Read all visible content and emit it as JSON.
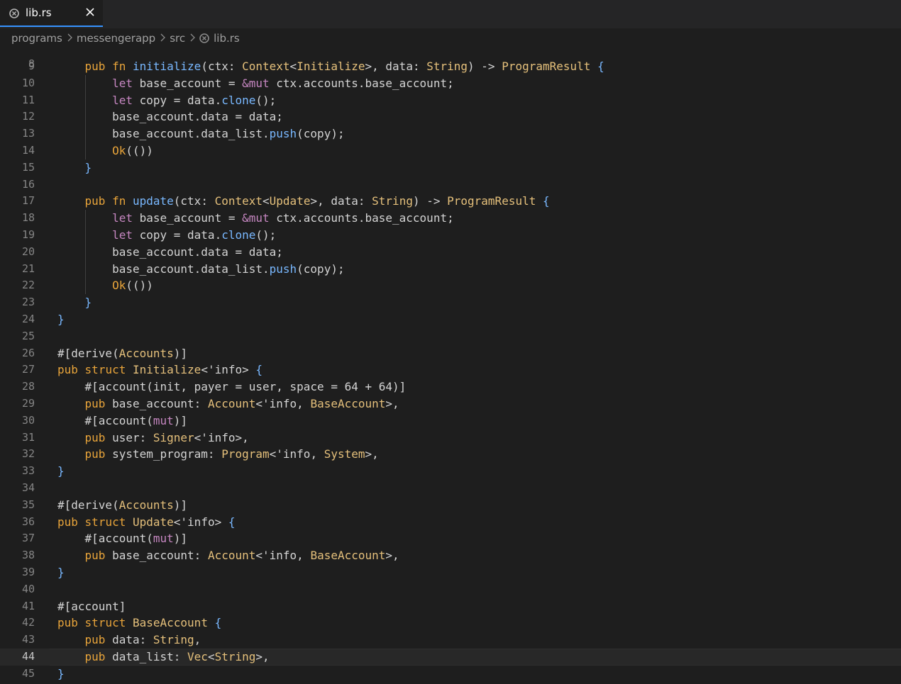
{
  "tab": {
    "label": "lib.rs",
    "icon": "rust-file-icon",
    "close_icon": "close-icon"
  },
  "breadcrumb": [
    "programs",
    "messengerapp",
    "src",
    "lib.rs"
  ],
  "editor": {
    "first_partial_line": "8",
    "current_line": 44,
    "lines": [
      {
        "n": 9,
        "segs": [
          [
            "    ",
            ""
          ],
          [
            "pub",
            "kw"
          ],
          [
            " ",
            ""
          ],
          [
            "fn",
            "kw"
          ],
          [
            " ",
            ""
          ],
          [
            "initialize",
            "fn"
          ],
          [
            "(ctx: ",
            ""
          ],
          [
            "Context",
            "ty"
          ],
          [
            "<",
            ""
          ],
          [
            "Initialize",
            "ty"
          ],
          [
            ">, data: ",
            ""
          ],
          [
            "String",
            "ty"
          ],
          [
            ") -> ",
            ""
          ],
          [
            "ProgramResult",
            "ty"
          ],
          [
            " ",
            ""
          ],
          [
            "{",
            "brace"
          ]
        ]
      },
      {
        "n": 10,
        "segs": [
          [
            "        ",
            ""
          ],
          [
            "let",
            "kw2"
          ],
          [
            " base_account = ",
            ""
          ],
          [
            "&mut",
            "mut"
          ],
          [
            " ctx.accounts.base_account;",
            ""
          ]
        ]
      },
      {
        "n": 11,
        "segs": [
          [
            "        ",
            ""
          ],
          [
            "let",
            "kw2"
          ],
          [
            " copy = data.",
            ""
          ],
          [
            "clone",
            "fn"
          ],
          [
            "();",
            ""
          ]
        ]
      },
      {
        "n": 12,
        "segs": [
          [
            "        base_account.data = data;",
            ""
          ]
        ]
      },
      {
        "n": 13,
        "segs": [
          [
            "        base_account.data_list.",
            ""
          ],
          [
            "push",
            "fn"
          ],
          [
            "(copy);",
            ""
          ]
        ]
      },
      {
        "n": 14,
        "segs": [
          [
            "        ",
            ""
          ],
          [
            "Ok",
            "macro"
          ],
          [
            "(())",
            ""
          ]
        ]
      },
      {
        "n": 15,
        "segs": [
          [
            "    ",
            ""
          ],
          [
            "}",
            "brace"
          ]
        ]
      },
      {
        "n": 16,
        "segs": [
          [
            "",
            ""
          ]
        ]
      },
      {
        "n": 17,
        "segs": [
          [
            "    ",
            ""
          ],
          [
            "pub",
            "kw"
          ],
          [
            " ",
            ""
          ],
          [
            "fn",
            "kw"
          ],
          [
            " ",
            ""
          ],
          [
            "update",
            "fn"
          ],
          [
            "(ctx: ",
            ""
          ],
          [
            "Context",
            "ty"
          ],
          [
            "<",
            ""
          ],
          [
            "Update",
            "ty"
          ],
          [
            ">, data: ",
            ""
          ],
          [
            "String",
            "ty"
          ],
          [
            ") -> ",
            ""
          ],
          [
            "ProgramResult",
            "ty"
          ],
          [
            " ",
            ""
          ],
          [
            "{",
            "brace"
          ]
        ]
      },
      {
        "n": 18,
        "segs": [
          [
            "        ",
            ""
          ],
          [
            "let",
            "kw2"
          ],
          [
            " base_account = ",
            ""
          ],
          [
            "&mut",
            "mut"
          ],
          [
            " ctx.accounts.base_account;",
            ""
          ]
        ]
      },
      {
        "n": 19,
        "segs": [
          [
            "        ",
            ""
          ],
          [
            "let",
            "kw2"
          ],
          [
            " copy = data.",
            ""
          ],
          [
            "clone",
            "fn"
          ],
          [
            "();",
            ""
          ]
        ]
      },
      {
        "n": 20,
        "segs": [
          [
            "        base_account.data = data;",
            ""
          ]
        ]
      },
      {
        "n": 21,
        "segs": [
          [
            "        base_account.data_list.",
            ""
          ],
          [
            "push",
            "fn"
          ],
          [
            "(copy);",
            ""
          ]
        ]
      },
      {
        "n": 22,
        "segs": [
          [
            "        ",
            ""
          ],
          [
            "Ok",
            "macro"
          ],
          [
            "(())",
            ""
          ]
        ]
      },
      {
        "n": 23,
        "segs": [
          [
            "    ",
            ""
          ],
          [
            "}",
            "brace"
          ]
        ]
      },
      {
        "n": 24,
        "segs": [
          [
            "}",
            "brace"
          ]
        ]
      },
      {
        "n": 25,
        "segs": [
          [
            "",
            ""
          ]
        ]
      },
      {
        "n": 26,
        "segs": [
          [
            "#[derive(",
            ""
          ],
          [
            "Accounts",
            "ty"
          ],
          [
            ")]",
            ""
          ]
        ]
      },
      {
        "n": 27,
        "segs": [
          [
            "pub",
            "kw"
          ],
          [
            " ",
            ""
          ],
          [
            "struct",
            "kw"
          ],
          [
            " ",
            ""
          ],
          [
            "Initialize",
            "ty"
          ],
          [
            "<'info> ",
            ""
          ],
          [
            "{",
            "brace"
          ]
        ]
      },
      {
        "n": 28,
        "segs": [
          [
            "    #[account(init, payer = user, space = 64 + 64)]",
            ""
          ]
        ]
      },
      {
        "n": 29,
        "segs": [
          [
            "    ",
            ""
          ],
          [
            "pub",
            "kw"
          ],
          [
            " base_account: ",
            ""
          ],
          [
            "Account",
            "ty"
          ],
          [
            "<'info, ",
            ""
          ],
          [
            "BaseAccount",
            "ty"
          ],
          [
            ">,",
            ""
          ]
        ]
      },
      {
        "n": 30,
        "segs": [
          [
            "    #[account(",
            ""
          ],
          [
            "mut",
            "mut"
          ],
          [
            ")]",
            ""
          ]
        ]
      },
      {
        "n": 31,
        "segs": [
          [
            "    ",
            ""
          ],
          [
            "pub",
            "kw"
          ],
          [
            " user: ",
            ""
          ],
          [
            "Signer",
            "ty"
          ],
          [
            "<'info>,",
            ""
          ]
        ]
      },
      {
        "n": 32,
        "segs": [
          [
            "    ",
            ""
          ],
          [
            "pub",
            "kw"
          ],
          [
            " system_program: ",
            ""
          ],
          [
            "Program",
            "ty"
          ],
          [
            "<'info, ",
            ""
          ],
          [
            "System",
            "ty"
          ],
          [
            ">,",
            ""
          ]
        ]
      },
      {
        "n": 33,
        "segs": [
          [
            "}",
            "brace"
          ]
        ]
      },
      {
        "n": 34,
        "segs": [
          [
            "",
            ""
          ]
        ]
      },
      {
        "n": 35,
        "segs": [
          [
            "#[derive(",
            ""
          ],
          [
            "Accounts",
            "ty"
          ],
          [
            ")]",
            ""
          ]
        ]
      },
      {
        "n": 36,
        "segs": [
          [
            "pub",
            "kw"
          ],
          [
            " ",
            ""
          ],
          [
            "struct",
            "kw"
          ],
          [
            " ",
            ""
          ],
          [
            "Update",
            "ty"
          ],
          [
            "<'info> ",
            ""
          ],
          [
            "{",
            "brace"
          ]
        ]
      },
      {
        "n": 37,
        "segs": [
          [
            "    #[account(",
            ""
          ],
          [
            "mut",
            "mut"
          ],
          [
            ")]",
            ""
          ]
        ]
      },
      {
        "n": 38,
        "segs": [
          [
            "    ",
            ""
          ],
          [
            "pub",
            "kw"
          ],
          [
            " base_account: ",
            ""
          ],
          [
            "Account",
            "ty"
          ],
          [
            "<'info, ",
            ""
          ],
          [
            "BaseAccount",
            "ty"
          ],
          [
            ">,",
            ""
          ]
        ]
      },
      {
        "n": 39,
        "segs": [
          [
            "}",
            "brace"
          ]
        ]
      },
      {
        "n": 40,
        "segs": [
          [
            "",
            ""
          ]
        ]
      },
      {
        "n": 41,
        "segs": [
          [
            "#[account]",
            ""
          ]
        ]
      },
      {
        "n": 42,
        "segs": [
          [
            "pub",
            "kw"
          ],
          [
            " ",
            ""
          ],
          [
            "struct",
            "kw"
          ],
          [
            " ",
            ""
          ],
          [
            "BaseAccount",
            "ty"
          ],
          [
            " ",
            ""
          ],
          [
            "{",
            "brace"
          ]
        ]
      },
      {
        "n": 43,
        "segs": [
          [
            "    ",
            ""
          ],
          [
            "pub",
            "kw"
          ],
          [
            " data: ",
            ""
          ],
          [
            "String",
            "ty"
          ],
          [
            ",",
            ""
          ]
        ]
      },
      {
        "n": 44,
        "segs": [
          [
            "    ",
            ""
          ],
          [
            "pub",
            "kw"
          ],
          [
            " data_list: ",
            ""
          ],
          [
            "Vec",
            "ty"
          ],
          [
            "<",
            ""
          ],
          [
            "String",
            "ty"
          ],
          [
            ">,",
            ""
          ]
        ]
      },
      {
        "n": 45,
        "segs": [
          [
            "}",
            "brace"
          ]
        ]
      }
    ]
  },
  "colors": {
    "background": "#1e1e1e",
    "tab_active_border": "#3794ff",
    "keyword": "#e8a43a",
    "keyword_let": "#c586c0",
    "function": "#79b8ff",
    "type": "#e5c07b"
  }
}
